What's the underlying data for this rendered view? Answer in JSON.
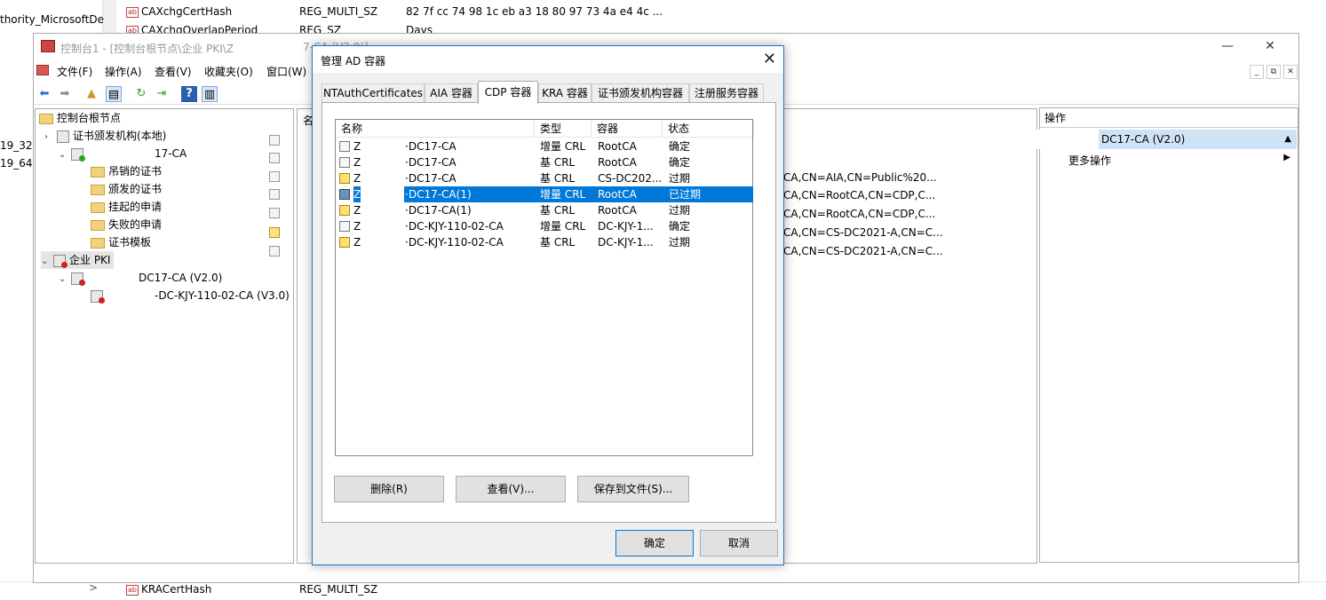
{
  "background_registry": {
    "left_text_1": "thority_MicrosoftDe",
    "left_text_2": "19_32",
    "left_text_3": "19_64",
    "rows": [
      {
        "name": "CAXchgCertHash",
        "type": "REG_MULTI_SZ",
        "data": "82 7f cc 74 98 1c eb a3 18 80 97 73 4a e4 4c ..."
      },
      {
        "name": "CAXchgOverlapPeriod",
        "type": "REG_SZ",
        "data": "Days"
      }
    ],
    "bottom_row": {
      "name": "KRACertHash",
      "type": "REG_MULTI_SZ"
    },
    "bottom_arrow": ">"
  },
  "mmc": {
    "title": "控制台1 - [控制台根节点\\企业 PKI\\Z",
    "title_suffix": "7-CA (V2.0)]",
    "window_controls": {
      "minimize": "—",
      "maximize": "☐",
      "close": "✕"
    },
    "menu": [
      "文件(F)",
      "操作(A)",
      "查看(V)",
      "收藏夹(O)",
      "窗口(W)"
    ],
    "child_controls": {
      "minimize": "_",
      "restore": "⧉",
      "close": "✕"
    },
    "tree": [
      {
        "label": "控制台根节点",
        "indent": 0
      },
      {
        "label": "证书颁发机构(本地)",
        "indent": 1
      },
      {
        "label": "17-CA",
        "indent": 2
      },
      {
        "label": "吊销的证书",
        "indent": 3
      },
      {
        "label": "颁发的证书",
        "indent": 3
      },
      {
        "label": "挂起的申请",
        "indent": 3
      },
      {
        "label": "失败的申请",
        "indent": 3
      },
      {
        "label": "证书模板",
        "indent": 3
      },
      {
        "label": "企业 PKI",
        "indent": 0
      },
      {
        "label": "DC17-CA (V2.0)",
        "indent": 1
      },
      {
        "label": "-DC-KJY-110-02-CA (V3.0)",
        "indent": 2
      }
    ],
    "center_header": "名",
    "center_rows": [
      "CA,CN=AIA,CN=Public%20...",
      "CA,CN=RootCA,CN=CDP,C...",
      "CA,CN=RootCA,CN=CDP,C...",
      "CA,CN=CS-DC2021-A,CN=C...",
      "CA,CN=CS-DC2021-A,CN=C..."
    ],
    "actions": {
      "header": "操作",
      "selected": "DC17-CA (V2.0)",
      "selected_arrow": "▲",
      "more": "更多操作",
      "more_arrow": "▶"
    }
  },
  "dialog": {
    "title": "管理 AD 容器",
    "close": "✕",
    "tabs": [
      "NTAuthCertificates",
      "AIA 容器",
      "CDP 容器",
      "KRA 容器",
      "证书颁发机构容器",
      "注册服务容器"
    ],
    "active_tab": "CDP 容器",
    "columns": [
      "名称",
      "类型",
      "容器",
      "状态"
    ],
    "rows": [
      {
        "prefix": "Z",
        "name": "DC17-CA",
        "type": "增量 CRL",
        "container": "RootCA",
        "status": "确定",
        "icon": "cert-icon",
        "selected": false
      },
      {
        "prefix": "Z",
        "name": "DC17-CA",
        "type": "基 CRL",
        "container": "RootCA",
        "status": "确定",
        "icon": "cert-icon",
        "selected": false
      },
      {
        "prefix": "Z",
        "name": "DC17-CA",
        "type": "基 CRL",
        "container": "CS-DC202...",
        "status": "过期",
        "icon": "warning-icon",
        "selected": false
      },
      {
        "prefix": "Z",
        "name": "DC17-CA(1)",
        "type": "增量 CRL",
        "container": "RootCA",
        "status": "已过期",
        "icon": "error-cert-icon",
        "selected": true
      },
      {
        "prefix": "Z",
        "name": "DC17-CA(1)",
        "type": "基 CRL",
        "container": "RootCA",
        "status": "过期",
        "icon": "warning-icon",
        "selected": false
      },
      {
        "prefix": "Z",
        "name": "DC-KJY-110-02-CA",
        "type": "增量 CRL",
        "container": "DC-KJY-1...",
        "status": "确定",
        "icon": "cert-icon",
        "selected": false
      },
      {
        "prefix": "Z",
        "name": "DC-KJY-110-02-CA",
        "type": "基 CRL",
        "container": "DC-KJY-1...",
        "status": "过期",
        "icon": "warning-icon",
        "selected": false
      }
    ],
    "buttons": {
      "delete": "删除(R)",
      "view": "查看(V)...",
      "save": "保存到文件(S)...",
      "ok": "确定",
      "cancel": "取消"
    }
  }
}
